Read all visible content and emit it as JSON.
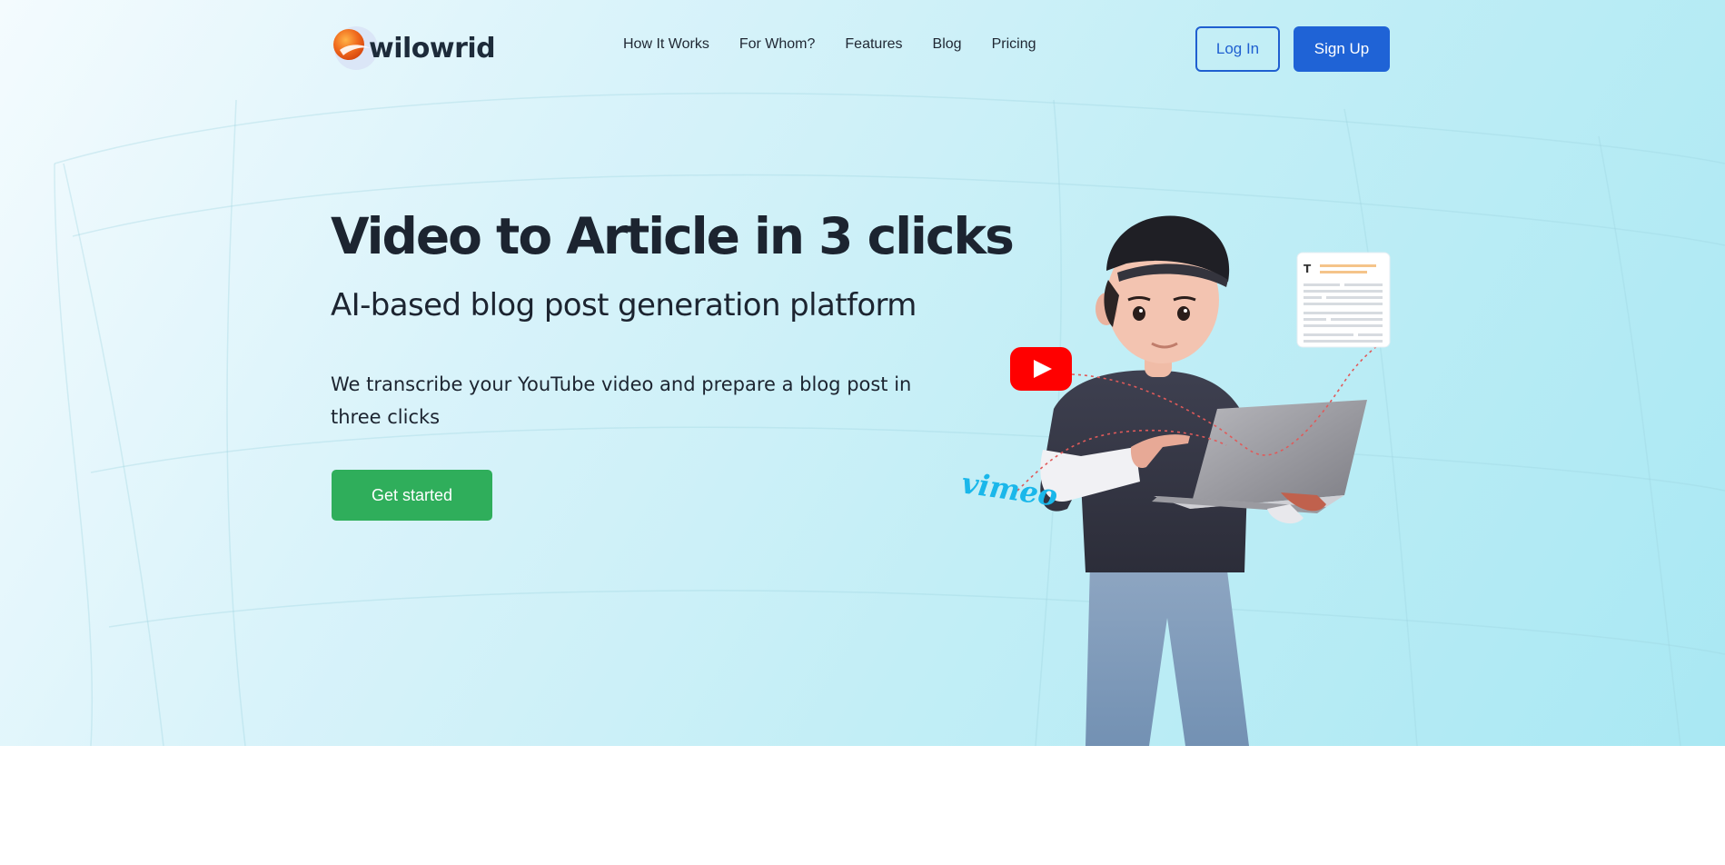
{
  "brand": {
    "name": "wilowrid"
  },
  "nav": {
    "items": [
      {
        "label": "How It Works"
      },
      {
        "label": "For Whom?"
      },
      {
        "label": "Features"
      },
      {
        "label": "Blog"
      },
      {
        "label": "Pricing"
      }
    ]
  },
  "auth": {
    "login_label": "Log In",
    "signup_label": "Sign Up"
  },
  "hero": {
    "title": "Video to Article in 3 clicks",
    "subtitle": "AI-based blog post generation platform",
    "description": "We transcribe your YouTube video and prepare a blog post in three clicks",
    "cta_label": "Get started"
  },
  "illustration": {
    "vimeo_label": "vimeo",
    "document_initial": "T"
  },
  "colors": {
    "primary_blue": "#1f63d6",
    "cta_green": "#2fae5b",
    "youtube_red": "#ff0000",
    "vimeo_blue": "#1ab7ea",
    "text_dark": "#1c2430"
  }
}
